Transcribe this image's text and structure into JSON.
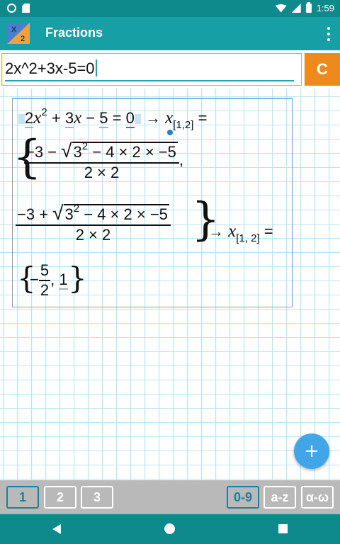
{
  "status_bar": {
    "time": "1:59"
  },
  "app_bar": {
    "title": "Fractions",
    "logo_top": "X",
    "logo_bottom": "2"
  },
  "input": {
    "value": "2x^2+3x-5=0",
    "clear_label": "C"
  },
  "solution": {
    "line1": {
      "a": "2",
      "x": "x",
      "exp": "2",
      "plus": "+",
      "b": "3",
      "x2": "x",
      "minus": "−",
      "c": "5",
      "eq": "=",
      "zero": "0",
      "arrow": "→",
      "var": "x",
      "sub": "[1,2]",
      "eq2": "="
    },
    "root1": {
      "prefix": "−3 −",
      "radicand_base": "3",
      "radicand_exp": "2",
      "radicand_rest": " − 4 × 2 × −5",
      "denominator": "2 × 2",
      "comma": ","
    },
    "root2": {
      "prefix": "−3 +",
      "radicand_base": "3",
      "radicand_exp": "2",
      "radicand_rest": " − 4 × 2 × −5",
      "denominator": "2 × 2",
      "arrow": "→",
      "var": "x",
      "sub": "[1, 2]",
      "eq": "="
    },
    "answer": {
      "minus": "−",
      "numerator": "5",
      "denominator": "2",
      "comma": ",",
      "second": "1"
    }
  },
  "fab": {
    "label": "+"
  },
  "keyboard_tabs": [
    {
      "label": "1",
      "active": true
    },
    {
      "label": "2",
      "active": false
    },
    {
      "label": "3",
      "active": false
    },
    {
      "label": "0-9",
      "active": true
    },
    {
      "label": "a-z",
      "active": false
    },
    {
      "label": "α-ω",
      "active": false
    }
  ],
  "colors": {
    "status_bar": "#0f8a8c",
    "app_bar": "#16a0a6",
    "clear_button": "#ee8a1d",
    "fab": "#42a5e8",
    "grid_line": "#bfe3f2",
    "active_tab": "#1e7f9e"
  }
}
